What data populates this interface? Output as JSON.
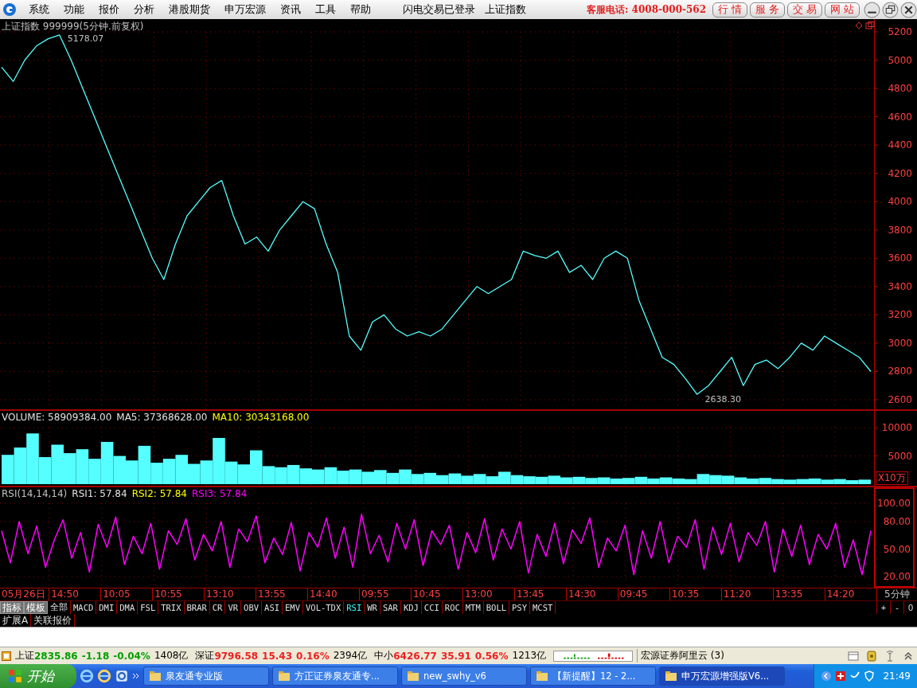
{
  "menu": [
    "系统",
    "功能",
    "报价",
    "分析",
    "港股期货",
    "申万宏源",
    "资讯",
    "工具",
    "帮助"
  ],
  "login_status": "闪电交易已登录",
  "current_index": "上证指数",
  "hotline": "客服电话: 4008-000-562",
  "quick_buttons": [
    "行 情",
    "服 务",
    "交 易",
    "网 站"
  ],
  "price_panel": {
    "title": "上证指数 999999(5分钟.前复权)",
    "chart_data": {
      "type": "line",
      "grid": true,
      "yticks": [
        5200,
        5000,
        4800,
        4600,
        4400,
        4200,
        4000,
        3800,
        3600,
        3400,
        3200,
        3000,
        2800,
        2600
      ],
      "ylim": [
        2600,
        5200
      ],
      "series": [
        {
          "color": "#55ffff",
          "values": [
            4950,
            4850,
            5000,
            5100,
            5150,
            5178,
            5000,
            4800,
            4600,
            4400,
            4200,
            4000,
            3800,
            3600,
            3450,
            3700,
            3900,
            4000,
            4100,
            4150,
            3900,
            3700,
            3750,
            3650,
            3800,
            3900,
            4000,
            3950,
            3700,
            3500,
            3050,
            2950,
            3150,
            3200,
            3100,
            3050,
            3080,
            3050,
            3100,
            3200,
            3300,
            3400,
            3350,
            3400,
            3450,
            3650,
            3620,
            3600,
            3650,
            3500,
            3550,
            3450,
            3600,
            3650,
            3600,
            3300,
            3100,
            2900,
            2850,
            2750,
            2638,
            2700,
            2800,
            2900,
            2700,
            2850,
            2880,
            2820,
            2900,
            3000,
            2950,
            3050,
            3000,
            2950,
            2900,
            2800
          ]
        }
      ],
      "annotations": [
        "5178.07",
        "2638.30"
      ]
    }
  },
  "volume_panel": {
    "label": "VOLUME: 58909384.00",
    "ma5": "MA5: 37368628.00",
    "ma10": "MA10: 30343168.00",
    "unit": "X10万",
    "chart_data": {
      "type": "bar",
      "grid": true,
      "yticks": [
        5000,
        10000
      ],
      "ylim": [
        0,
        13000
      ],
      "series": [
        {
          "color": "#55ffff",
          "values": [
            5200,
            6500,
            9000,
            4800,
            7000,
            5500,
            6200,
            4500,
            7500,
            5000,
            4200,
            6800,
            3800,
            4500,
            5200,
            3600,
            4200,
            8200,
            4000,
            3500,
            6000,
            3200,
            3000,
            3400,
            2800,
            2600,
            3000,
            2400,
            2600,
            2200,
            2500,
            2000,
            2600,
            1800,
            2000,
            1600,
            1900,
            1500,
            1800,
            1400,
            2200,
            1600,
            1400,
            1300,
            1500,
            1200,
            1300,
            1100,
            1200,
            1000,
            1100,
            1300,
            1000,
            1200,
            1000,
            900,
            1800,
            1600,
            1500,
            1200,
            1000,
            1100,
            900,
            800,
            900,
            1000,
            800,
            900,
            700,
            800
          ]
        }
      ]
    }
  },
  "rsi_panel": {
    "label": "RSI(14,14,14)",
    "rsi1": "RSI1: 57.84",
    "rsi2": "RSI2: 57.84",
    "rsi3": "RSI3: 57.84",
    "chart_data": {
      "type": "line",
      "grid": true,
      "ylim": [
        20,
        100
      ],
      "yticks": [
        {
          "value": 20,
          "label": "20.00"
        },
        {
          "value": 50,
          "label": "50.00"
        },
        {
          "value": 80,
          "label": "80.00"
        },
        {
          "value": 100,
          "label": "100.00"
        }
      ],
      "series": [
        {
          "color": "#ff00ff",
          "values": [
            70,
            35,
            80,
            45,
            75,
            30,
            60,
            82,
            40,
            68,
            25,
            77,
            52,
            85,
            33,
            64,
            45,
            78,
            28,
            70,
            55,
            83,
            38,
            66,
            48,
            80,
            30,
            72,
            58,
            86,
            35,
            62,
            44,
            79,
            26,
            68,
            52,
            84,
            40,
            74,
            30,
            88,
            45,
            65,
            36,
            78,
            50,
            82,
            32,
            70,
            55,
            76,
            28,
            68,
            46,
            83,
            38,
            72,
            50,
            80,
            24,
            66,
            42,
            78,
            34,
            71,
            56,
            84,
            30,
            62,
            48,
            76,
            22,
            70,
            40,
            80,
            35,
            64,
            52,
            82,
            28,
            74,
            44,
            78,
            36,
            68,
            54,
            80,
            25,
            72,
            42,
            76,
            33,
            66,
            50,
            78,
            30,
            60,
            22,
            70
          ]
        }
      ]
    }
  },
  "time_axis": [
    "05月26日",
    "14:50",
    "10:05",
    "10:55",
    "13:10",
    "13:55",
    "14:40",
    "09:55",
    "10:45",
    "13:00",
    "13:45",
    "14:30",
    "09:45",
    "10:35",
    "11:20",
    "13:35",
    "14:20"
  ],
  "period": "5分钟",
  "panel_buttons": [
    "指标",
    "模板"
  ],
  "indicator_tabs": [
    {
      "label": "全部",
      "selected": false
    },
    {
      "label": "MACD",
      "selected": false
    },
    {
      "label": "DMI",
      "selected": false
    },
    {
      "label": "DMA",
      "selected": false
    },
    {
      "label": "FSL",
      "selected": false
    },
    {
      "label": "TRIX",
      "selected": false
    },
    {
      "label": "BRAR",
      "selected": false
    },
    {
      "label": "CR",
      "selected": false
    },
    {
      "label": "VR",
      "selected": false
    },
    {
      "label": "OBV",
      "selected": false
    },
    {
      "label": "ASI",
      "selected": false
    },
    {
      "label": "EMV",
      "selected": false
    },
    {
      "label": "VOL-TDX",
      "selected": false
    },
    {
      "label": "RSI",
      "selected": true
    },
    {
      "label": "WR",
      "selected": false
    },
    {
      "label": "SAR",
      "selected": false
    },
    {
      "label": "KDJ",
      "selected": false
    },
    {
      "label": "CCI",
      "selected": false
    },
    {
      "label": "ROC",
      "selected": false
    },
    {
      "label": "MTM",
      "selected": false
    },
    {
      "label": "BOLL",
      "selected": false
    },
    {
      "label": "PSY",
      "selected": false
    },
    {
      "label": "MCST",
      "selected": false
    }
  ],
  "zoom_buttons": [
    "+",
    "-",
    "0"
  ],
  "extra_tabs": [
    "扩展A",
    "关联报价"
  ],
  "status_bar": {
    "indices": [
      {
        "name": "上证",
        "value": "2835.86",
        "change": "-1.18",
        "pct": "-0.04%",
        "amount": "1408亿",
        "color": "#00a000"
      },
      {
        "name": "深证",
        "value": "9796.58",
        "change": "15.43",
        "pct": "0.16%",
        "amount": "2394亿",
        "color": "#ee2020"
      },
      {
        "name": "中小",
        "value": "6426.77",
        "change": "35.91",
        "pct": "0.56%",
        "amount": "1213亿",
        "color": "#ee2020"
      }
    ],
    "server": "宏源证券阿里云 (3)"
  },
  "taskbar": {
    "start": "开始",
    "tasks": [
      {
        "label": "泉友通专业版",
        "selected": false
      },
      {
        "label": "方正证券泉友通专...",
        "selected": false
      },
      {
        "label": "new_swhy_v6",
        "selected": false
      },
      {
        "label": "【新提醒】12 - 2...",
        "selected": false
      },
      {
        "label": "申万宏源增强版V6...",
        "selected": true
      }
    ],
    "clock": "21:49"
  }
}
